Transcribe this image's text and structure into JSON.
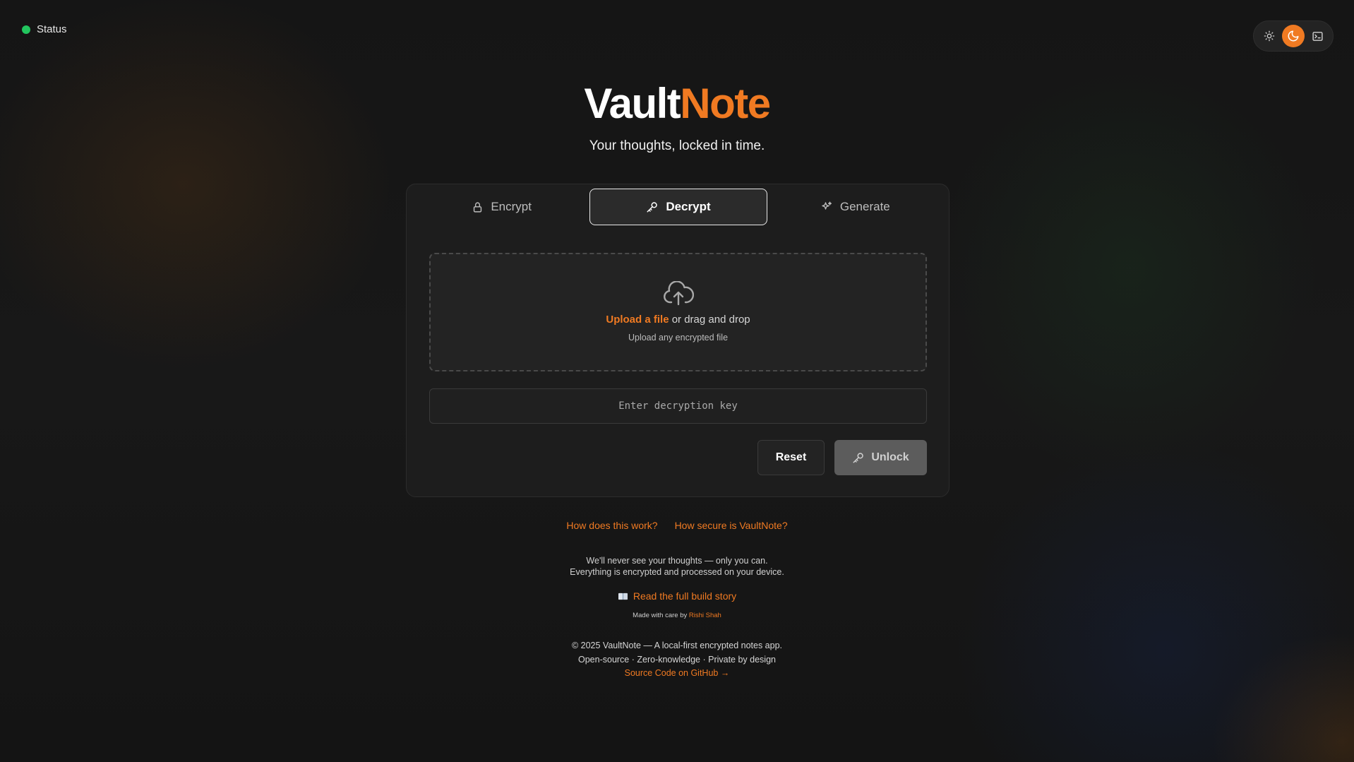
{
  "status": {
    "label": "Status",
    "color": "#22c55e"
  },
  "theme_switch": {
    "options": [
      {
        "icon": "sun-icon",
        "active": false
      },
      {
        "icon": "moon-icon",
        "active": true
      },
      {
        "icon": "terminal-icon",
        "active": false
      }
    ],
    "accent": "#f07a22"
  },
  "brand": {
    "part1": "Vault",
    "part2": "Note",
    "tagline": "Your thoughts, locked in time."
  },
  "tabs": [
    {
      "label": "Encrypt",
      "icon": "lock-icon",
      "active": false
    },
    {
      "label": "Decrypt",
      "icon": "key-icon",
      "active": true
    },
    {
      "label": "Generate",
      "icon": "sparkles-icon",
      "active": false
    }
  ],
  "dropzone": {
    "upload_link": "Upload a file",
    "upload_rest": " or drag and drop",
    "hint": "Upload any encrypted file"
  },
  "key_input": {
    "placeholder": "Enter decryption key",
    "value": ""
  },
  "actions": {
    "reset": "Reset",
    "unlock": "Unlock"
  },
  "help_links": [
    "How does this work?",
    "How secure is VaultNote?"
  ],
  "privacy_note": {
    "line1": "We'll never see your thoughts — only you can.",
    "line2": "Everything is encrypted and processed on your device."
  },
  "story_link": "Read the full build story",
  "made_with": {
    "prefix": "Made with care by ",
    "author": "Rishi Shah"
  },
  "footer": {
    "copyright": "© 2025 VaultNote — A local-first encrypted notes app.",
    "tags": "Open-source · Zero-knowledge · Private by design",
    "source": "Source Code on GitHub →"
  }
}
